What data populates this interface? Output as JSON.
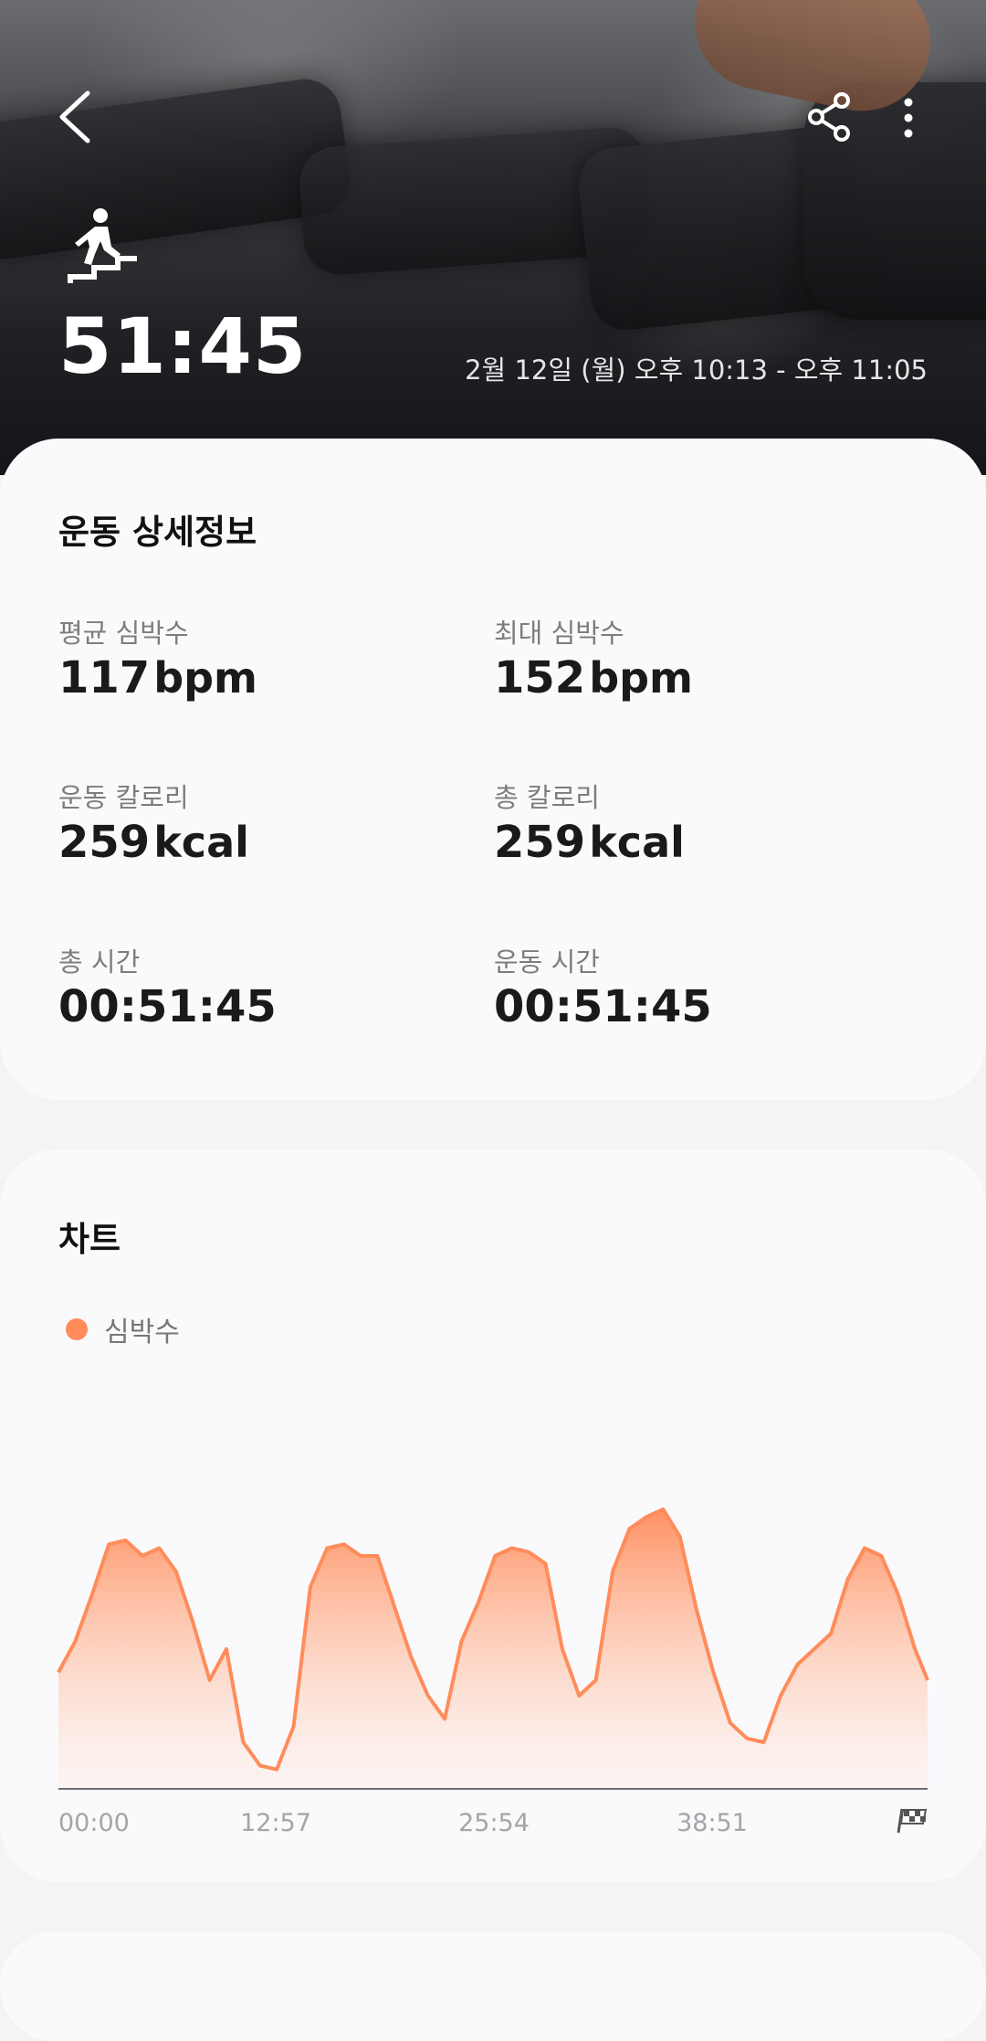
{
  "header": {
    "back_icon": "chevron-left-icon",
    "share_icon": "share-icon",
    "more_icon": "more-vertical-icon",
    "activity_icon": "stair-climbing-icon",
    "duration": "51:45",
    "datetime": "2월 12일 (월) 오후 10:13 - 오후 11:05"
  },
  "details": {
    "title": "운동 상세정보",
    "stats": [
      {
        "label": "평균 심박수",
        "value": "117",
        "unit": "bpm"
      },
      {
        "label": "최대 심박수",
        "value": "152",
        "unit": "bpm"
      },
      {
        "label": "운동 칼로리",
        "value": "259",
        "unit": "kcal"
      },
      {
        "label": "총 칼로리",
        "value": "259",
        "unit": "kcal"
      },
      {
        "label": "총 시간",
        "value": "00:51:45",
        "unit": ""
      },
      {
        "label": "운동 시간",
        "value": "00:51:45",
        "unit": ""
      }
    ]
  },
  "chart": {
    "title": "차트",
    "legend_label": "심박수",
    "accent_color": "#ff8c5a",
    "finish_icon": "checkered-flag-icon"
  },
  "chart_data": {
    "type": "area",
    "series": [
      {
        "name": "심박수"
      }
    ],
    "x_tick_labels": [
      "00:00",
      "12:57",
      "25:54",
      "38:51"
    ],
    "x_end_marker": "finish-flag",
    "x": [
      0,
      1,
      2,
      3,
      4,
      5,
      6,
      7,
      8,
      9,
      10,
      11,
      12,
      13,
      14,
      15,
      16,
      17,
      18,
      19,
      20,
      21,
      22,
      23,
      24,
      25,
      26,
      27,
      28,
      29,
      30,
      31,
      32,
      33,
      34,
      35,
      36,
      37,
      38,
      39,
      40,
      41,
      42,
      43,
      44,
      45,
      46,
      47,
      48,
      49,
      50,
      51,
      51.75
    ],
    "values": [
      110,
      118,
      130,
      143,
      144,
      140,
      142,
      136,
      123,
      108,
      116,
      92,
      86,
      85,
      96,
      132,
      142,
      143,
      140,
      140,
      127,
      114,
      104,
      98,
      118,
      128,
      140,
      142,
      141,
      138,
      116,
      104,
      108,
      136,
      147,
      150,
      152,
      145,
      126,
      110,
      97,
      93,
      92,
      104,
      112,
      116,
      120,
      134,
      142,
      140,
      130,
      116,
      108
    ],
    "ylim": [
      80,
      160
    ],
    "grid": false
  }
}
